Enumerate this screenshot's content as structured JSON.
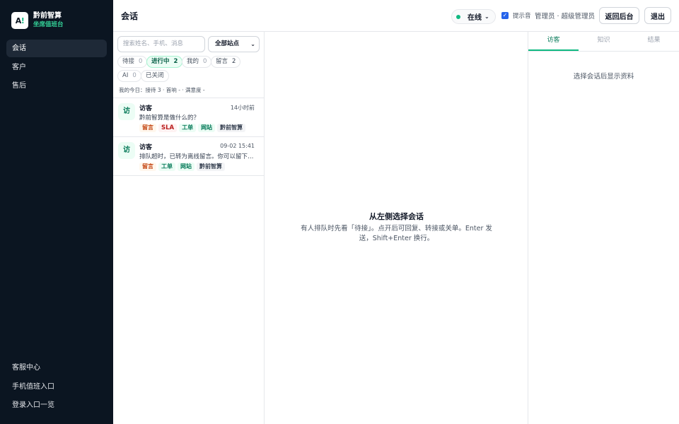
{
  "brand": {
    "logo_main": "A",
    "logo_accent": "!",
    "name": "黔前智算",
    "subtitle": "坐席值班台"
  },
  "sidebar": {
    "items": [
      {
        "label": "会话",
        "active": true
      },
      {
        "label": "客户",
        "active": false
      },
      {
        "label": "售后",
        "active": false
      }
    ],
    "bottom_items": [
      {
        "label": "客服中心"
      },
      {
        "label": "手机值班入口"
      },
      {
        "label": "登录入口一览"
      }
    ]
  },
  "topbar": {
    "title": "会话",
    "status": "在线",
    "status_color": "#10b981",
    "sound_label": "提示音",
    "sound_checked": true,
    "admin": "管理员 · 超级管理员",
    "back_button": "返回后台",
    "logout_button": "退出"
  },
  "list": {
    "search_placeholder": "搜索姓名、手机、消息",
    "site_select": "全部站点",
    "filters": [
      {
        "label": "待接",
        "count": "0"
      },
      {
        "label": "进行中",
        "count": "2",
        "active": true
      },
      {
        "label": "我的",
        "count": "0"
      },
      {
        "label": "留言",
        "count": "2"
      },
      {
        "label": "AI",
        "count": "0"
      },
      {
        "label": "已关闭",
        "count": ""
      }
    ],
    "stats": "我的今日：接待 3 · 首响 - · 满意度 -",
    "conversations": [
      {
        "avatar": "访",
        "name": "访客",
        "time": "14小时前",
        "message": "黔前智算是做什么的？",
        "tags": [
          "留言",
          "SLA",
          "工单",
          "网站",
          "黔前智算"
        ]
      },
      {
        "avatar": "访",
        "name": "访客",
        "time": "09-02 15:41",
        "message": "排队超时，已转为离线留言。你可以留下联系方式",
        "tags": [
          "留言",
          "工单",
          "网站",
          "黔前智算"
        ]
      }
    ]
  },
  "center": {
    "title": "从左侧选择会话",
    "description": "有人排队时先看「待接」。点开后可回复、转接或关单。Enter 发送，Shift+Enter 换行。"
  },
  "right_panel": {
    "tabs": [
      {
        "label": "访客",
        "active": true
      },
      {
        "label": "知识",
        "active": false
      },
      {
        "label": "结果",
        "active": false
      }
    ],
    "empty": "选择会话后显示资料"
  },
  "colors": {
    "sidebar_bg": "#0b1521",
    "accent": "#10b981"
  },
  "icons": {
    "status_caret": "chevron-down-icon",
    "select_caret": "chevron-down-icon",
    "checkbox": "check-icon"
  }
}
